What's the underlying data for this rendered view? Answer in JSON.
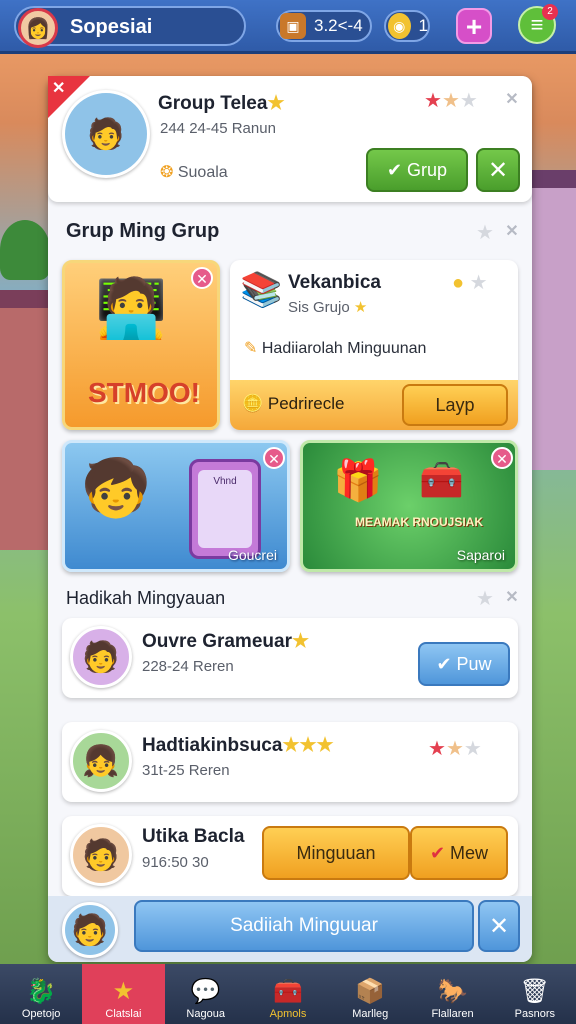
{
  "topbar": {
    "profile_name": "Sopesiai",
    "stat_1": "3.2<-4",
    "stat_2": "1",
    "menu_badge": "2"
  },
  "group_card": {
    "title": "Group Telea",
    "subtitle": "244 24-45 Ranun",
    "tag": "Suoala",
    "grup_button": "Grup"
  },
  "section_1": {
    "heading": "Grup Ming Grup"
  },
  "tile_stmoo": {
    "label": "STMOO!"
  },
  "info_card": {
    "title": "Vekanbica",
    "subtitle": "Sis Grujo",
    "line": "Hadiiarolah Minguunan",
    "footer_label": "Pedrirecle",
    "button": "Layp"
  },
  "tile_phone": {
    "screen_text": "Vhnd",
    "caption": "Goucrei"
  },
  "tile_chest": {
    "banner": "MEAMAK RNOUJSIAK",
    "caption": "Saparoi"
  },
  "section_2": {
    "heading": "Hadikah Mingyauan"
  },
  "list": [
    {
      "title": "Ouvre Grameuar",
      "subtitle": "228-24 Reren",
      "button": "Puw"
    },
    {
      "title": "Hadtiakinbsuca",
      "subtitle": "31t-25 Reren"
    },
    {
      "title": "Utika Bacla",
      "subtitle": "916:50 30",
      "button_1": "Minguuan",
      "button_2": "Mew"
    }
  ],
  "footer_bar": {
    "button": "Sadiiah Minguuar"
  },
  "nav": [
    {
      "label": "Opetojo",
      "icon": "dragon-icon"
    },
    {
      "label": "Clatslai",
      "icon": "star-icon"
    },
    {
      "label": "Nagoua",
      "icon": "chat-icon"
    },
    {
      "label": "Apmols",
      "icon": "chest-icon"
    },
    {
      "label": "Marlleg",
      "icon": "box-icon"
    },
    {
      "label": "Flallaren",
      "icon": "horse-icon"
    },
    {
      "label": "Pasnors",
      "icon": "trash-icon"
    }
  ],
  "colors": {
    "topbar": "#2f5ba8",
    "nav_active": "#e0405a",
    "green": "#4a9e2c",
    "blue": "#4f96da",
    "orange": "#f0a020"
  }
}
